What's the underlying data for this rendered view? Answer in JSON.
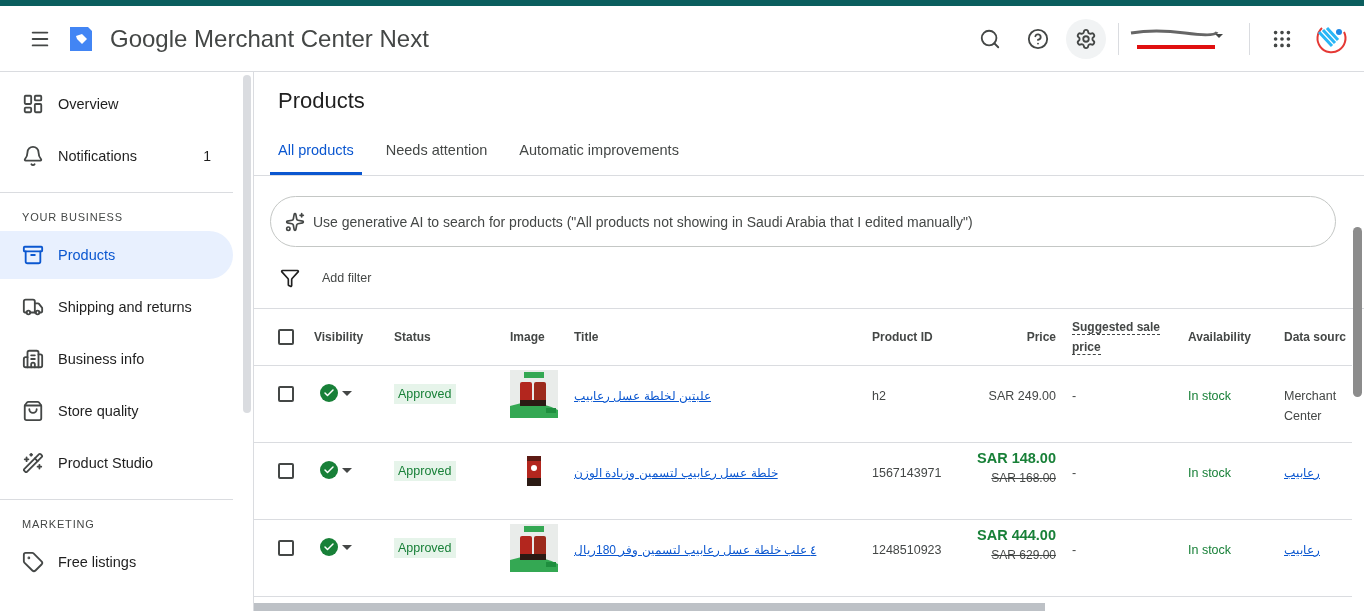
{
  "app": {
    "title": "Google Merchant Center Next"
  },
  "sidebar": {
    "sections": [
      {
        "items": [
          {
            "label": "Overview",
            "selected": false
          },
          {
            "label": "Notifications",
            "badge": "1",
            "selected": false
          }
        ]
      },
      {
        "heading": "YOUR BUSINESS",
        "items": [
          {
            "label": "Products",
            "selected": true
          },
          {
            "label": "Shipping and returns",
            "selected": false
          },
          {
            "label": "Business info",
            "selected": false
          },
          {
            "label": "Store quality",
            "selected": false
          },
          {
            "label": "Product Studio",
            "selected": false
          }
        ]
      },
      {
        "heading": "MARKETING",
        "items": [
          {
            "label": "Free listings",
            "selected": false
          }
        ]
      }
    ]
  },
  "page": {
    "title": "Products"
  },
  "tabs": [
    {
      "label": "All products",
      "selected": true
    },
    {
      "label": "Needs attention",
      "selected": false
    },
    {
      "label": "Automatic improvements",
      "selected": false
    }
  ],
  "search": {
    "placeholder": "Use generative AI to search for products (\"All products not showing in Saudi Arabia that I edited manually\")"
  },
  "filter": {
    "label": "Add filter"
  },
  "table": {
    "select_all": {
      "checked": false
    },
    "columns": [
      "Visibility",
      "Status",
      "Image",
      "Title",
      "Product ID",
      "Price",
      "Suggested sale price",
      "Availability",
      "Data sourc"
    ],
    "rows": [
      {
        "checked": false,
        "visible": true,
        "status": "Approved",
        "title": "علبتين لخلطة عسل رعابيب",
        "product_id": "h2",
        "price": {
          "kind": "regular",
          "current": "SAR 249.00"
        },
        "suggested": "-",
        "availability": "In stock",
        "data_source": {
          "kind": "text",
          "text": "Merchant Center"
        }
      },
      {
        "checked": false,
        "visible": true,
        "status": "Approved",
        "title": "خلطة عسل رعابيب لتسمين وزيادة الوزن",
        "product_id": "1567143971",
        "price": {
          "kind": "sale",
          "current": "SAR 148.00",
          "original": "SAR 168.00"
        },
        "suggested": "-",
        "availability": "In stock",
        "data_source": {
          "kind": "link",
          "text": "رعابيب"
        }
      },
      {
        "checked": false,
        "visible": true,
        "status": "Approved",
        "title": "٤ علب خلطة عسل رعابيب لتسمين وفر 180ريال",
        "product_id": "1248510923",
        "price": {
          "kind": "sale",
          "current": "SAR 444.00",
          "original": "SAR 629.00"
        },
        "suggested": "-",
        "availability": "In stock",
        "data_source": {
          "kind": "link",
          "text": "رعابيب"
        }
      }
    ]
  }
}
